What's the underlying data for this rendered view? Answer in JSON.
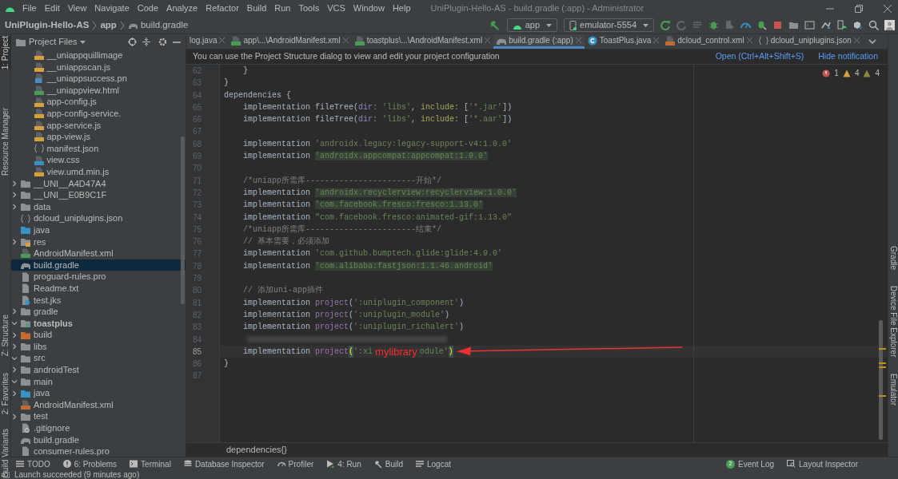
{
  "window": {
    "title": "UniPlugin-Hello-AS - build.gradle (:app) - Administrator"
  },
  "menu": [
    "File",
    "Edit",
    "View",
    "Navigate",
    "Code",
    "Analyze",
    "Refactor",
    "Build",
    "Run",
    "Tools",
    "VCS",
    "Window",
    "Help"
  ],
  "breadcrumb": [
    "UniPlugin-Hello-AS",
    "app",
    "build.gradle"
  ],
  "toolbar": {
    "configuration": "app",
    "device": "emulator-5554"
  },
  "left_strip": [
    "1: Project",
    "Resource Manager",
    "Z: Structure",
    "2: Favorites",
    "Build Variants"
  ],
  "right_strip": [
    "Gradle",
    "Device File Explorer",
    "Emulator"
  ],
  "project_panel": {
    "title": "Project Files",
    "tree": [
      {
        "children": [
          {
            "children": [
              {
                "children": [
                  {
                    "children": [
                      {
                        "children": [
                          {
                            "children": [
                              {
                                "children": [
                                  {
                                    "label": "__uniappquillimage",
                                    "kind": "js",
                                    "selected": false
                                  },
                                  {
                                    "label": "__uniappscan.js",
                                    "kind": "js",
                                    "selected": false
                                  },
                                  {
                                    "label": "__uniappsuccess.pn",
                                    "kind": "png",
                                    "selected": false
                                  },
                                  {
                                    "label": "__uniappview.html",
                                    "kind": "html",
                                    "selected": false
                                  },
                                  {
                                    "label": "app-config.js",
                                    "kind": "js",
                                    "selected": false
                                  },
                                  {
                                    "label": "app-config-service.",
                                    "kind": "js",
                                    "selected": false
                                  },
                                  {
                                    "label": "app-service.js",
                                    "kind": "js",
                                    "selected": false
                                  },
                                  {
                                    "label": "app-view.js",
                                    "kind": "js",
                                    "selected": false
                                  },
                                  {
                                    "label": "manifest.json",
                                    "kind": "json",
                                    "selected": false
                                  },
                                  {
                                    "label": "view.css",
                                    "kind": "css",
                                    "selected": false
                                  },
                                  {
                                    "label": "view.umd.min.js",
                                    "kind": "js",
                                    "selected": false
                                  }
                                ]
                              }
                            ]
                          },
                          {
                            "label": "__UNI__A4D47A4",
                            "kind": "folder",
                            "expanded": false,
                            "selected": false
                          },
                          {
                            "label": "__UNI__E0B9C1F",
                            "kind": "folder",
                            "expanded": false,
                            "selected": false
                          }
                        ]
                      },
                      {
                        "label": "data",
                        "kind": "folder",
                        "expanded": false,
                        "selected": false
                      },
                      {
                        "label": "dcloud_uniplugins.json",
                        "kind": "json",
                        "selected": false
                      }
                    ]
                  },
                  {
                    "label": "java",
                    "kind": "source",
                    "selected": false
                  },
                  {
                    "label": "res",
                    "kind": "resfolder",
                    "expanded": false,
                    "selected": false
                  },
                  {
                    "label": "AndroidManifest.xml",
                    "kind": "manifest",
                    "selected": false
                  }
                ]
              }
            ]
          },
          {
            "label": "build.gradle",
            "kind": "gradle",
            "selected": true
          },
          {
            "label": "proguard-rules.pro",
            "kind": "text",
            "selected": false
          },
          {
            "label": "Readme.txt",
            "kind": "text",
            "selected": false
          },
          {
            "label": "test.jks",
            "kind": "jks",
            "selected": false
          }
        ]
      },
      {
        "label": "gradle",
        "kind": "folder",
        "expanded": false,
        "selected": false
      },
      {
        "label": "toastplus",
        "kind": "module",
        "expanded": true,
        "selected": false,
        "children": [
          {
            "label": "build",
            "kind": "excluded",
            "expanded": false,
            "selected": false
          },
          {
            "label": "libs",
            "kind": "folder",
            "expanded": false,
            "selected": false
          },
          {
            "label": "src",
            "kind": "folder",
            "expanded": true,
            "selected": false,
            "children": [
              {
                "label": "androidTest",
                "kind": "folder",
                "expanded": false,
                "selected": false
              },
              {
                "label": "main",
                "kind": "folder",
                "expanded": true,
                "selected": false,
                "children": [
                  {
                    "label": "java",
                    "kind": "source",
                    "expanded": false,
                    "selected": false
                  },
                  {
                    "label": "AndroidManifest.xml",
                    "kind": "xml",
                    "selected": false
                  }
                ]
              },
              {
                "label": "test",
                "kind": "folder",
                "expanded": false,
                "selected": false
              }
            ]
          },
          {
            "label": ".gitignore",
            "kind": "git",
            "selected": false
          },
          {
            "label": "build.gradle",
            "kind": "gradle",
            "selected": false
          },
          {
            "label": "consumer-rules.pro",
            "kind": "text",
            "selected": false
          }
        ]
      }
    ]
  },
  "tabs": [
    {
      "label": "log.java",
      "selected": false
    },
    {
      "label": "app\\...\\AndroidManifest.xml",
      "kind": "manifest",
      "selected": false
    },
    {
      "label": "toastplus\\...\\AndroidManifest.xml",
      "kind": "manifest",
      "selected": false
    },
    {
      "label": "build.gradle (:app)",
      "kind": "gradle",
      "selected": true
    },
    {
      "label": "ToastPlus.java",
      "kind": "class",
      "selected": false
    },
    {
      "label": "dcloud_control.xml",
      "kind": "xml",
      "selected": false
    },
    {
      "label": "dcloud_uniplugins.json",
      "kind": "json",
      "selected": false
    }
  ],
  "notification": {
    "text": "You can use the Project Structure dialog to view and edit your project configuration",
    "links": [
      "Open (Ctrl+Alt+Shift+S)",
      "Hide notification"
    ]
  },
  "inspections": [
    {
      "kind": "error",
      "count": "1"
    },
    {
      "kind": "warning",
      "count": "4"
    },
    {
      "kind": "weak",
      "count": "4"
    }
  ],
  "editor": {
    "lines": [
      {
        "number": "62",
        "tokens": [
          {
            "kind": "plain",
            "text": "    }"
          }
        ]
      },
      {
        "number": "63",
        "tokens": [
          {
            "kind": "plain",
            "text": "}"
          }
        ]
      },
      {
        "number": "64",
        "tokens": [
          {
            "kind": "plain",
            "text": "dependencies {"
          }
        ]
      },
      {
        "number": "65",
        "tokens": [
          {
            "kind": "plain",
            "text": "    implementation fileTree("
          },
          {
            "kind": "arg",
            "text": "dir: "
          },
          {
            "kind": "string",
            "text": "'libs'"
          },
          {
            "kind": "plain",
            "text": ", "
          },
          {
            "kind": "arg2",
            "text": "include: "
          },
          {
            "kind": "plain",
            "text": "["
          },
          {
            "kind": "string",
            "text": "'*.jar'"
          },
          {
            "kind": "plain",
            "text": "])"
          }
        ]
      },
      {
        "number": "66",
        "tokens": [
          {
            "kind": "plain",
            "text": "    implementation fileTree("
          },
          {
            "kind": "arg",
            "text": "dir: "
          },
          {
            "kind": "string",
            "text": "'libs'"
          },
          {
            "kind": "plain",
            "text": ", "
          },
          {
            "kind": "arg2",
            "text": "include: "
          },
          {
            "kind": "plain",
            "text": "["
          },
          {
            "kind": "string",
            "text": "'*.aar'"
          },
          {
            "kind": "plain",
            "text": "])"
          }
        ]
      },
      {
        "number": "67"
      },
      {
        "number": "68",
        "tokens": [
          {
            "kind": "plain",
            "text": "    implementation "
          },
          {
            "kind": "string",
            "text": "'androidx.legacy:legacy-support-v4:1.0.0'"
          }
        ]
      },
      {
        "number": "69",
        "tokens": [
          {
            "kind": "plain",
            "text": "    implementation "
          },
          {
            "kind": "marked",
            "text": "'androidx.appcompat:appcompat:1.0.0'"
          }
        ]
      },
      {
        "number": "70"
      },
      {
        "number": "71",
        "tokens": [
          {
            "kind": "comment",
            "text": "    /*uniapp所需库-----------------------开始*/"
          }
        ]
      },
      {
        "number": "72",
        "tokens": [
          {
            "kind": "plain",
            "text": "    implementation "
          },
          {
            "kind": "marked",
            "text": "'androidx.recyclerview:recyclerview:1.0.0'"
          }
        ]
      },
      {
        "number": "73",
        "tokens": [
          {
            "kind": "plain",
            "text": "    implementation "
          },
          {
            "kind": "marked",
            "text": "'com.facebook.fresco:fresco:1.13.0'"
          }
        ]
      },
      {
        "number": "74",
        "tokens": [
          {
            "kind": "plain",
            "text": "    implementation "
          },
          {
            "kind": "string",
            "text": "\"com.facebook.fresco:animated-gif:1.13.0\""
          }
        ]
      },
      {
        "number": "75",
        "tokens": [
          {
            "kind": "comment",
            "text": "    /*uniapp所需库-----------------------结束*/"
          }
        ]
      },
      {
        "number": "76",
        "tokens": [
          {
            "kind": "comment",
            "text": "    // 基本需要，必须添加"
          }
        ]
      },
      {
        "number": "77",
        "tokens": [
          {
            "kind": "plain",
            "text": "    implementation "
          },
          {
            "kind": "string",
            "text": "'com.github.bumptech.glide:glide:4.9.0'"
          }
        ]
      },
      {
        "number": "78",
        "tokens": [
          {
            "kind": "plain",
            "text": "    implementation "
          },
          {
            "kind": "marked",
            "text": "'com.alibaba:fastjson:1.1.46.android'"
          }
        ]
      },
      {
        "number": "79"
      },
      {
        "number": "80",
        "tokens": [
          {
            "kind": "comment",
            "text": "    // 添加uni-app插件"
          }
        ]
      },
      {
        "number": "81",
        "tokens": [
          {
            "kind": "plain",
            "text": "    implementation "
          },
          {
            "kind": "method",
            "text": "project"
          },
          {
            "kind": "plain",
            "text": "("
          },
          {
            "kind": "string",
            "text": "':uniplugin_component'"
          },
          {
            "kind": "plain",
            "text": ")"
          }
        ]
      },
      {
        "number": "82",
        "tokens": [
          {
            "kind": "plain",
            "text": "    implementation "
          },
          {
            "kind": "method",
            "text": "project"
          },
          {
            "kind": "plain",
            "text": "("
          },
          {
            "kind": "string",
            "text": "':uniplugin_module'"
          },
          {
            "kind": "plain",
            "text": ")"
          }
        ]
      },
      {
        "number": "83",
        "tokens": [
          {
            "kind": "plain",
            "text": "    implementation "
          },
          {
            "kind": "method",
            "text": "project"
          },
          {
            "kind": "plain",
            "text": "("
          },
          {
            "kind": "string",
            "text": "':uniplugin_richalert'"
          },
          {
            "kind": "plain",
            "text": ")"
          }
        ]
      },
      {
        "number": "84",
        "kind": "blurred"
      },
      {
        "number": "85",
        "current": true,
        "tokens": [
          {
            "kind": "plain",
            "text": "    implementation "
          },
          {
            "kind": "method",
            "text": "project"
          },
          {
            "kind": "bracket",
            "text": "("
          },
          {
            "kind": "string",
            "text": "':xi"
          },
          {
            "kind": "note",
            "text": "mylibrary"
          },
          {
            "kind": "string",
            "text": "odule'"
          },
          {
            "kind": "bracket",
            "text": ")"
          }
        ],
        "arrow": true
      },
      {
        "number": "86",
        "tokens": [
          {
            "kind": "plain",
            "text": "}"
          }
        ]
      },
      {
        "number": "87"
      }
    ],
    "breadcrumb": "dependencies{}"
  },
  "bottom_tools": [
    {
      "label": "TODO"
    },
    {
      "label": "6: Problems"
    },
    {
      "label": "Terminal"
    },
    {
      "label": "Database Inspector"
    },
    {
      "label": "Profiler"
    },
    {
      "label": "4: Run"
    },
    {
      "label": "Build"
    },
    {
      "label": "Logcat"
    }
  ],
  "bottom_tools_right": [
    {
      "label": "Event Log",
      "badge": "2"
    },
    {
      "label": "Layout Inspector"
    }
  ],
  "status_bar": "Launch succeeded (9 minutes ago)"
}
